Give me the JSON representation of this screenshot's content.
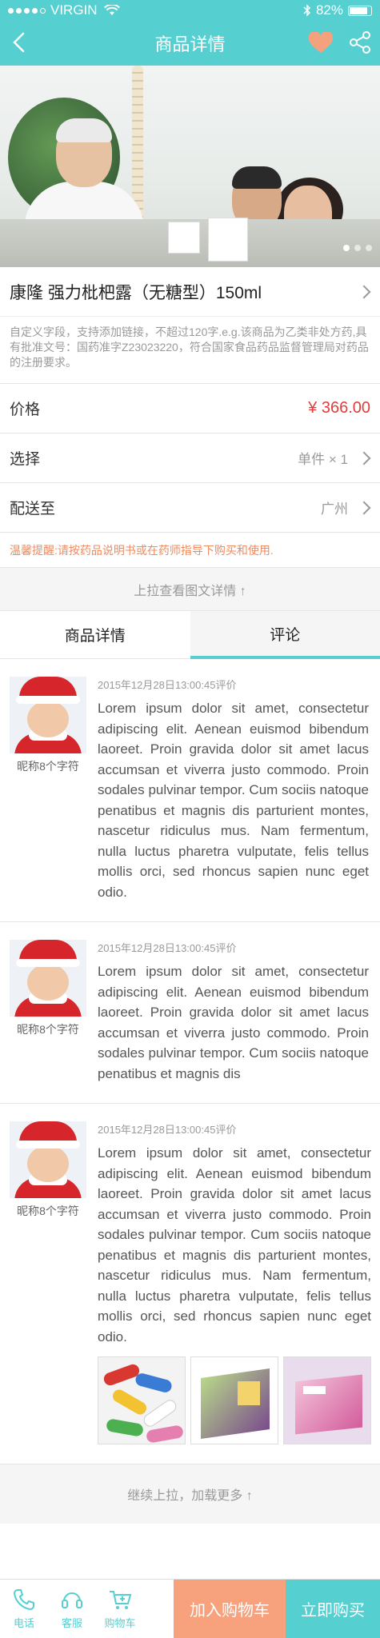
{
  "status": {
    "carrier": "VIRGIN",
    "battery": "82%"
  },
  "nav": {
    "title": "商品详情"
  },
  "product": {
    "title": "康隆 强力枇杷露（无糖型）150ml",
    "description": "自定义字段，支持添加链接，不超过120字.e.g.该商品为乙类非处方药,具有批准文号：国药准字Z23023220，符合国家食品药品监督管理局对药品的注册要求。"
  },
  "rows": {
    "price_label": "价格",
    "price_value": "¥ 366.00",
    "select_label": "选择",
    "select_value": "单件 × 1",
    "delivery_label": "配送至",
    "delivery_value": "广州"
  },
  "tip": "温馨提醒:请按药品说明书或在药师指导下购买和使用.",
  "pull_hint": "上拉查看图文详情 ↑",
  "tabs": {
    "detail": "商品详情",
    "review": "评论"
  },
  "comments": [
    {
      "nickname": "昵称8个字符",
      "time": "2015年12月28日13:00:45评价",
      "text": "Lorem ipsum dolor sit amet, consectetur adipiscing elit. Aenean euismod bibendum laoreet. Proin gravida dolor sit amet lacus accumsan et viverra justo commodo. Proin sodales pulvinar tempor. Cum sociis natoque penatibus et magnis dis parturient montes, nascetur ridiculus mus. Nam fermentum, nulla luctus pharetra vulputate, felis tellus mollis orci, sed rhoncus sapien nunc eget odio."
    },
    {
      "nickname": "昵称8个字符",
      "time": "2015年12月28日13:00:45评价",
      "text": "Lorem ipsum dolor sit amet, consectetur adipiscing elit. Aenean euismod bibendum laoreet. Proin gravida dolor sit amet lacus accumsan et viverra justo commodo. Proin sodales pulvinar tempor. Cum sociis natoque penatibus et magnis dis"
    },
    {
      "nickname": "昵称8个字符",
      "time": "2015年12月28日13:00:45评价",
      "text": "Lorem ipsum dolor sit amet, consectetur adipiscing elit. Aenean euismod bibendum laoreet. Proin gravida dolor sit amet lacus accumsan et viverra justo commodo. Proin sodales pulvinar tempor. Cum sociis natoque penatibus et magnis dis parturient montes, nascetur ridiculus mus. Nam fermentum, nulla luctus pharetra vulputate, felis tellus mollis orci, sed rhoncus sapien nunc eget odio."
    }
  ],
  "load_more": "继续上拉，加载更多 ↑",
  "bottom": {
    "phone": "电话",
    "service": "客服",
    "cart": "购物车",
    "add_to_cart": "加入购物车",
    "buy_now": "立即购买"
  },
  "colors": {
    "accent": "#55cfd0",
    "price": "#e23b3b",
    "cart_button": "#f8a27d",
    "heart": "#f4a27e"
  }
}
